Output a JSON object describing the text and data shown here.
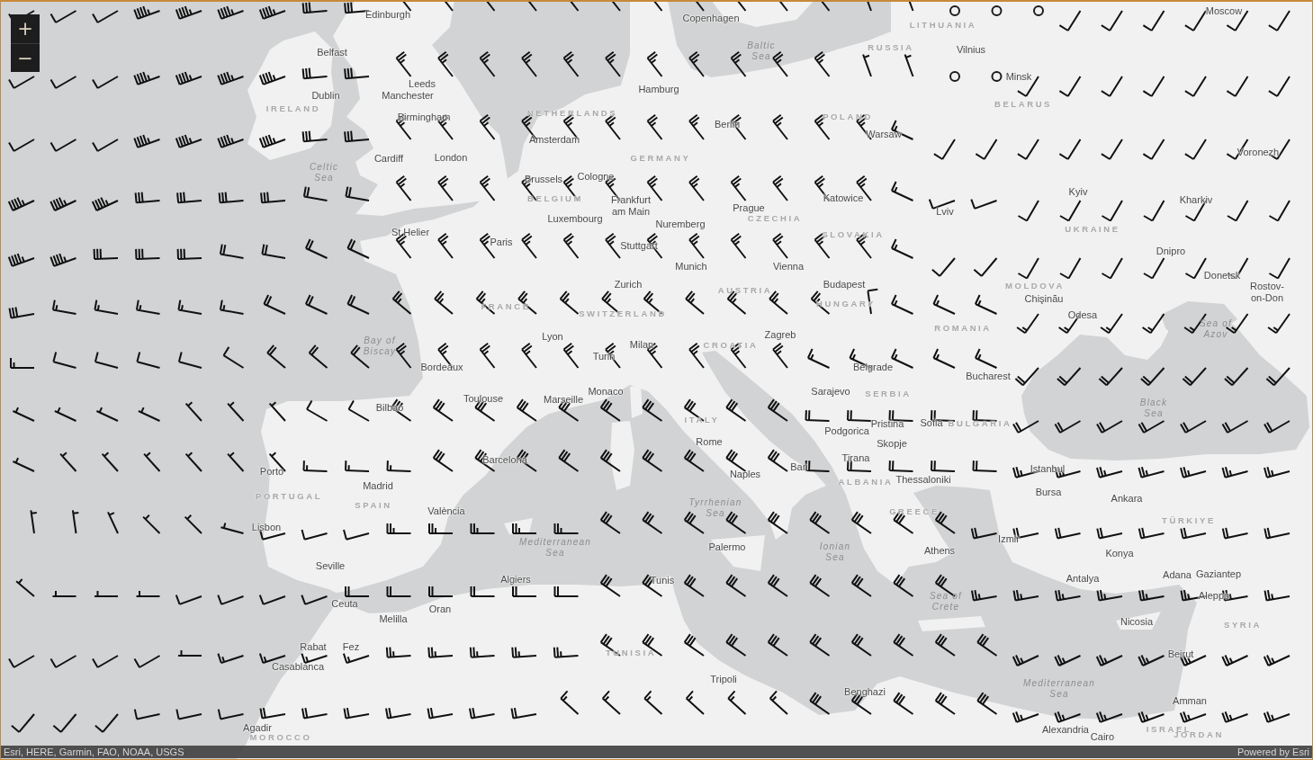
{
  "map": {
    "zoom_controls": [
      {
        "label": "+"
      },
      {
        "label": "−"
      }
    ],
    "labels": [
      {
        "text": "Edinburgh",
        "kind": "city"
      },
      {
        "text": "Copenhagen",
        "kind": "city"
      },
      {
        "text": "Moscow",
        "kind": "city"
      },
      {
        "text": "LITHUANIA",
        "kind": "country"
      },
      {
        "text": "Belfast",
        "kind": "city"
      },
      {
        "text": "Baltic Sea",
        "kind": "sea"
      },
      {
        "text": "RUSSIA",
        "kind": "country"
      },
      {
        "text": "Vilnius",
        "kind": "city"
      },
      {
        "text": "Leeds",
        "kind": "city"
      },
      {
        "text": "Minsk",
        "kind": "city"
      },
      {
        "text": "Dublin",
        "kind": "city"
      },
      {
        "text": "Manchester",
        "kind": "city"
      },
      {
        "text": "Hamburg",
        "kind": "city"
      },
      {
        "text": "BELARUS",
        "kind": "country"
      },
      {
        "text": "IRELAND",
        "kind": "country"
      },
      {
        "text": "NETHERLANDS",
        "kind": "country"
      },
      {
        "text": "Birmingham",
        "kind": "city"
      },
      {
        "text": "Amsterdam",
        "kind": "city"
      },
      {
        "text": "Berlin",
        "kind": "city"
      },
      {
        "text": "POLAND",
        "kind": "country"
      },
      {
        "text": "Warsaw",
        "kind": "city"
      },
      {
        "text": "Voronezh",
        "kind": "city"
      },
      {
        "text": "Cardiff",
        "kind": "city"
      },
      {
        "text": "London",
        "kind": "city"
      },
      {
        "text": "GERMANY",
        "kind": "country"
      },
      {
        "text": "Celtic Sea",
        "kind": "sea"
      },
      {
        "text": "Brussels",
        "kind": "city"
      },
      {
        "text": "Cologne",
        "kind": "city"
      },
      {
        "text": "BELGIUM",
        "kind": "country"
      },
      {
        "text": "Kyiv",
        "kind": "city"
      },
      {
        "text": "Frankfurt am Main",
        "kind": "city"
      },
      {
        "text": "Prague",
        "kind": "city"
      },
      {
        "text": "Katowice",
        "kind": "city"
      },
      {
        "text": "Kharkiv",
        "kind": "city"
      },
      {
        "text": "Lviv",
        "kind": "city"
      },
      {
        "text": "Luxembourg",
        "kind": "city"
      },
      {
        "text": "CZECHIA",
        "kind": "country"
      },
      {
        "text": "Nuremberg",
        "kind": "city"
      },
      {
        "text": "St Helier",
        "kind": "city"
      },
      {
        "text": "UKRAINE",
        "kind": "country"
      },
      {
        "text": "Paris",
        "kind": "city"
      },
      {
        "text": "Stuttgart",
        "kind": "city"
      },
      {
        "text": "SLOVAKIA",
        "kind": "country"
      },
      {
        "text": "Dnipro",
        "kind": "city"
      },
      {
        "text": "Munich",
        "kind": "city"
      },
      {
        "text": "Vienna",
        "kind": "city"
      },
      {
        "text": "Donetsk",
        "kind": "city"
      },
      {
        "text": "Zurich",
        "kind": "city"
      },
      {
        "text": "AUSTRIA",
        "kind": "country"
      },
      {
        "text": "Budapest",
        "kind": "city"
      },
      {
        "text": "MOLDOVA",
        "kind": "country"
      },
      {
        "text": "Chişinău",
        "kind": "city"
      },
      {
        "text": "Rostov-on-Don",
        "kind": "city"
      },
      {
        "text": "FRANCE",
        "kind": "country"
      },
      {
        "text": "SWITZERLAND",
        "kind": "country"
      },
      {
        "text": "HUNGARY",
        "kind": "country"
      },
      {
        "text": "Odesa",
        "kind": "city"
      },
      {
        "text": "ROMANIA",
        "kind": "country"
      },
      {
        "text": "Sea of Azov",
        "kind": "sea"
      },
      {
        "text": "Lyon",
        "kind": "city"
      },
      {
        "text": "Zagreb",
        "kind": "city"
      },
      {
        "text": "Bay of Biscay",
        "kind": "sea"
      },
      {
        "text": "Milan",
        "kind": "city"
      },
      {
        "text": "Turin",
        "kind": "city"
      },
      {
        "text": "CROATIA",
        "kind": "country"
      },
      {
        "text": "Bordeaux",
        "kind": "city"
      },
      {
        "text": "Belgrade",
        "kind": "city"
      },
      {
        "text": "Bucharest",
        "kind": "city"
      },
      {
        "text": "Toulouse",
        "kind": "city"
      },
      {
        "text": "Monaco",
        "kind": "city"
      },
      {
        "text": "Sarajevo",
        "kind": "city"
      },
      {
        "text": "SERBIA",
        "kind": "country"
      },
      {
        "text": "Bilbao",
        "kind": "city"
      },
      {
        "text": "Marseille",
        "kind": "city"
      },
      {
        "text": "Black Sea",
        "kind": "sea"
      },
      {
        "text": "ITALY",
        "kind": "country"
      },
      {
        "text": "Pristina",
        "kind": "city"
      },
      {
        "text": "Sofia",
        "kind": "city"
      },
      {
        "text": "BULGARIA",
        "kind": "country"
      },
      {
        "text": "Podgorica",
        "kind": "city"
      },
      {
        "text": "Rome",
        "kind": "city"
      },
      {
        "text": "Skopje",
        "kind": "city"
      },
      {
        "text": "Barcelona",
        "kind": "city"
      },
      {
        "text": "Tirana",
        "kind": "city"
      },
      {
        "text": "Porto",
        "kind": "city"
      },
      {
        "text": "Bari",
        "kind": "city"
      },
      {
        "text": "Istanbul",
        "kind": "city"
      },
      {
        "text": "Naples",
        "kind": "city"
      },
      {
        "text": "Madrid",
        "kind": "city"
      },
      {
        "text": "ALBANIA",
        "kind": "country"
      },
      {
        "text": "Thessaloniki",
        "kind": "city"
      },
      {
        "text": "Bursa",
        "kind": "city"
      },
      {
        "text": "PORTUGAL",
        "kind": "country"
      },
      {
        "text": "Ankara",
        "kind": "city"
      },
      {
        "text": "SPAIN",
        "kind": "country"
      },
      {
        "text": "València",
        "kind": "city"
      },
      {
        "text": "Tyrrhenian Sea",
        "kind": "sea"
      },
      {
        "text": "GREECE",
        "kind": "country"
      },
      {
        "text": "TÜRKIYE",
        "kind": "country"
      },
      {
        "text": "Lisbon",
        "kind": "city"
      },
      {
        "text": "Izmir",
        "kind": "city"
      },
      {
        "text": "Mediterranean Sea",
        "kind": "sea"
      },
      {
        "text": "Palermo",
        "kind": "city"
      },
      {
        "text": "Ionian Sea",
        "kind": "sea"
      },
      {
        "text": "Athens",
        "kind": "city"
      },
      {
        "text": "Konya",
        "kind": "city"
      },
      {
        "text": "Seville",
        "kind": "city"
      },
      {
        "text": "Algiers",
        "kind": "city"
      },
      {
        "text": "Tunis",
        "kind": "city"
      },
      {
        "text": "Antalya",
        "kind": "city"
      },
      {
        "text": "Adana",
        "kind": "city"
      },
      {
        "text": "Gaziantep",
        "kind": "city"
      },
      {
        "text": "Sea of Crete",
        "kind": "sea"
      },
      {
        "text": "Aleppo",
        "kind": "city"
      },
      {
        "text": "Ceuta",
        "kind": "city"
      },
      {
        "text": "Oran",
        "kind": "city"
      },
      {
        "text": "Melilla",
        "kind": "city"
      },
      {
        "text": "Nicosia",
        "kind": "city"
      },
      {
        "text": "SYRIA",
        "kind": "country"
      },
      {
        "text": "Rabat",
        "kind": "city"
      },
      {
        "text": "Fez",
        "kind": "city"
      },
      {
        "text": "TUNISIA",
        "kind": "country"
      },
      {
        "text": "Beirut",
        "kind": "city"
      },
      {
        "text": "Casablanca",
        "kind": "city"
      },
      {
        "text": "Tripoli",
        "kind": "city"
      },
      {
        "text": "Benghazi",
        "kind": "city"
      },
      {
        "text": "Mediterranean Sea",
        "kind": "sea"
      },
      {
        "text": "Amman",
        "kind": "city"
      },
      {
        "text": "Agadir",
        "kind": "city"
      },
      {
        "text": "Alexandria",
        "kind": "city"
      },
      {
        "text": "ISRAEL",
        "kind": "country"
      },
      {
        "text": "MOROCCO",
        "kind": "country"
      },
      {
        "text": "Cairo",
        "kind": "city"
      },
      {
        "text": "JORDAN",
        "kind": "country"
      }
    ]
  },
  "attribution": {
    "sources": "Esri, HERE, Garmin, FAO, NOAA, USGS",
    "powered_by": "Powered by Esri"
  }
}
